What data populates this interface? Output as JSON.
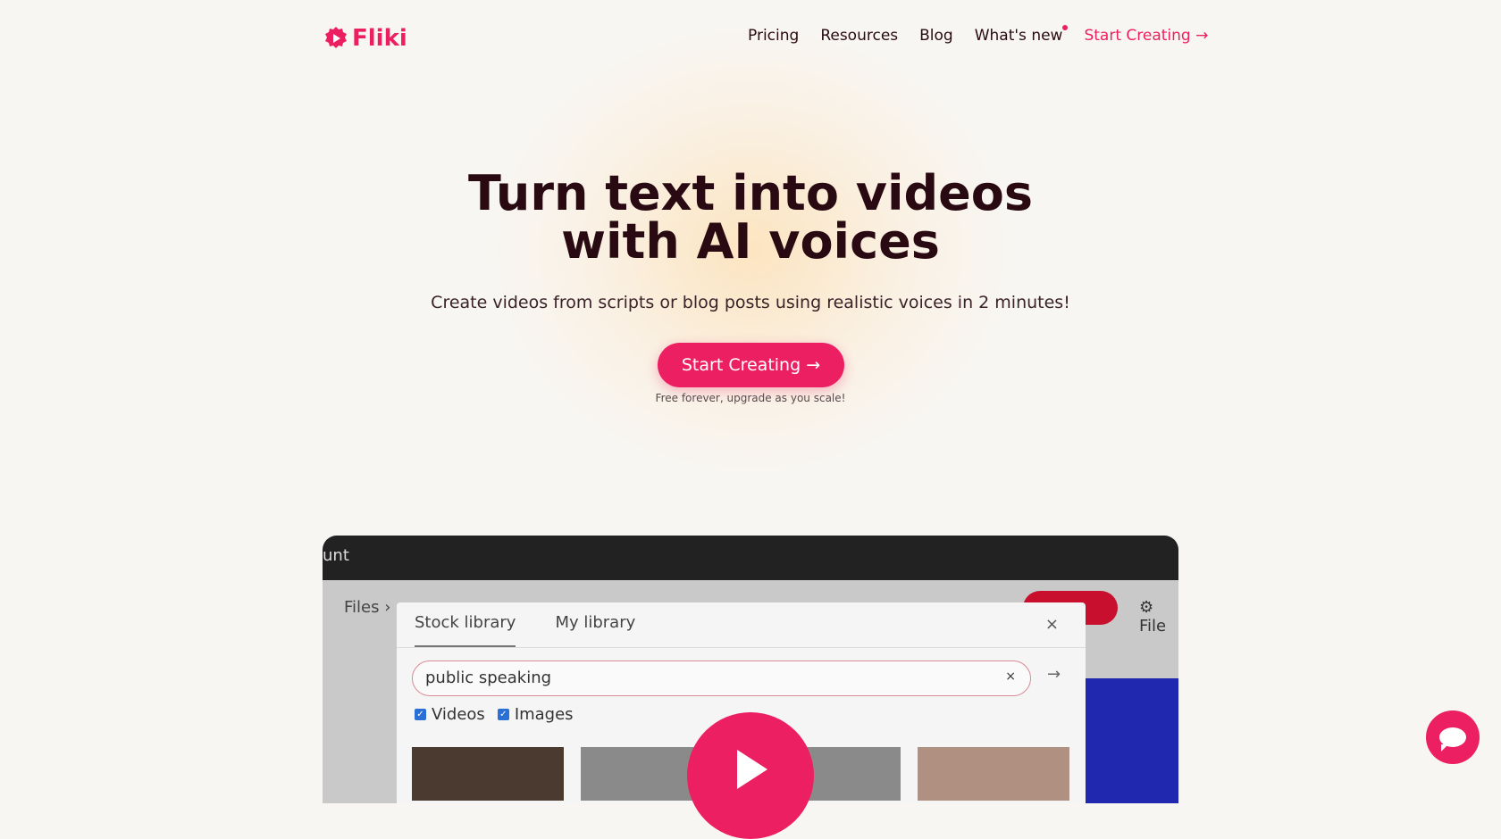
{
  "brand": {
    "name": "Fliki",
    "accent": "#ec1f63"
  },
  "nav": {
    "items": [
      "Pricing",
      "Resources",
      "Blog",
      "What's new"
    ],
    "cta": "Start Creating →"
  },
  "hero": {
    "title_line1": "Turn text into videos",
    "title_line2": "with AI voices",
    "subtitle": "Create videos from scripts or blog posts using realistic voices in 2 minutes!",
    "button": "Start Creating →",
    "note": "Free forever, upgrade as you scale!"
  },
  "preview": {
    "topbar": "unt",
    "breadcrumb": "Files ›",
    "file_button": "⚙ File",
    "tabs": [
      "Stock library",
      "My library"
    ],
    "close": "×",
    "search_value": "public speaking",
    "search_clear": "×",
    "submit": "→",
    "checkboxes": [
      "Videos",
      "Images"
    ]
  }
}
